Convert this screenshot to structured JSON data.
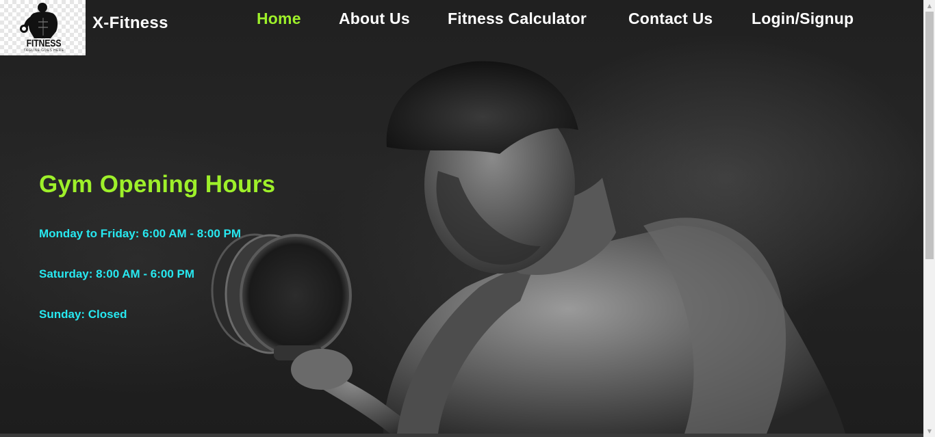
{
  "header": {
    "logo": {
      "word": "FITNESS",
      "tagline": "TAGLINE GOES HERE",
      "icon": "bodybuilder-logo-icon"
    },
    "brand": "X-Fitness"
  },
  "nav": {
    "items": [
      {
        "label": "Home",
        "active": true
      },
      {
        "label": "About Us",
        "active": false
      },
      {
        "label": "Fitness Calculator",
        "active": false
      },
      {
        "label": "Contact Us",
        "active": false
      },
      {
        "label": "Login/Signup",
        "active": false
      }
    ]
  },
  "hero": {
    "title": "Gym Opening Hours",
    "hours": [
      "Monday to Friday: 6:00 AM - 8:00 PM",
      "Saturday: 8:00 AM - 6:00 PM",
      "Sunday: Closed"
    ],
    "image": "bodybuilder-with-dumbbell-image"
  },
  "colors": {
    "accent_green": "#9ef02a",
    "hours_cyan": "#27e8f0",
    "nav_text": "#ffffff",
    "background": "#202020"
  }
}
